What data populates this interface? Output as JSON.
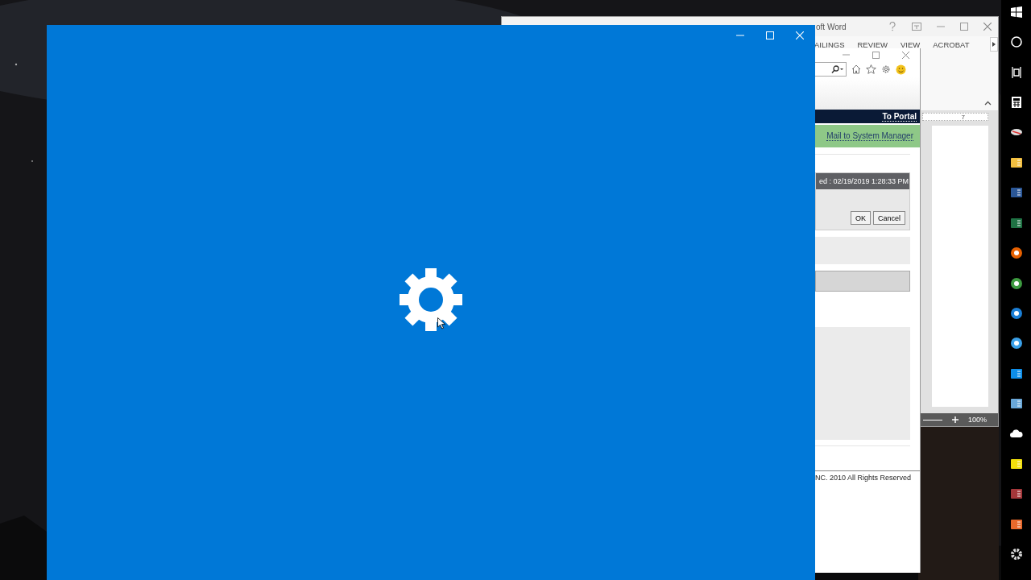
{
  "word_window": {
    "title": "oft Word",
    "ribbon_tabs": [
      "AILINGS",
      "REVIEW",
      "VIEW",
      "ACROBAT"
    ],
    "ruler_mark": "7",
    "zoom_level": "100%"
  },
  "browser_window": {
    "portal_link": "To Portal",
    "mail_link": "Mail to System Manager",
    "dialog": {
      "header": "ed : 02/19/2019 1:28:33 PM",
      "buttons": [
        "OK",
        "Cancel"
      ]
    },
    "footer": "NC. 2010 All Rights Reserved"
  }
}
